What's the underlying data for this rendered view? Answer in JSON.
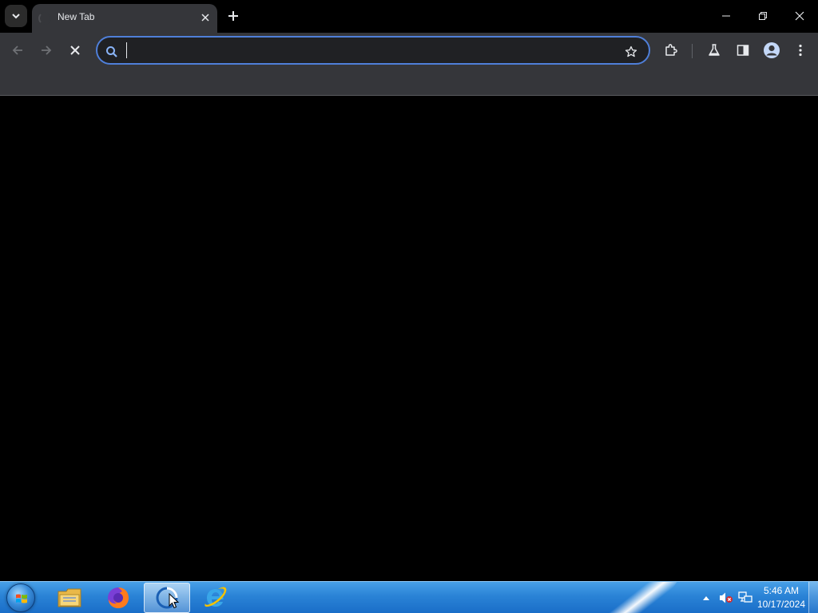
{
  "browser": {
    "tabs": [
      {
        "title": "New Tab",
        "loading": true
      }
    ],
    "omnibox": {
      "value": "",
      "placeholder": "",
      "focused": true
    },
    "reload_state": "stop",
    "icons": {
      "tab_search": "chevron-down-icon",
      "tab_close": "close-icon",
      "new_tab": "plus-icon",
      "minimize": "minimize-icon",
      "restore": "restore-icon",
      "close": "close-icon",
      "back": "arrow-left-icon",
      "forward": "arrow-right-icon",
      "stop": "close-icon",
      "search": "search-icon",
      "bookmark": "star-icon",
      "extensions": "puzzle-icon",
      "labs": "flask-icon",
      "side_panel": "side-panel-icon",
      "profile": "person-icon",
      "menu": "kebab-menu-icon"
    },
    "colors": {
      "omnibox_focus": "#4f7fd9",
      "toolbar": "#35363a",
      "content": "#000000"
    }
  },
  "taskbar": {
    "apps": [
      {
        "name": "Windows Explorer",
        "icon": "folder-icon",
        "active": false
      },
      {
        "name": "Firefox",
        "icon": "firefox-icon",
        "active": false
      },
      {
        "name": "Chrome",
        "icon": "chrome-loading-icon",
        "active": true
      },
      {
        "name": "Internet Explorer",
        "icon": "ie-icon",
        "active": false
      }
    ],
    "tray": {
      "icons": [
        "show-hidden-icons-arrow",
        "volume-muted-icon",
        "network-icon"
      ]
    },
    "clock": {
      "time": "5:46 AM",
      "date": "10/17/2024"
    }
  }
}
